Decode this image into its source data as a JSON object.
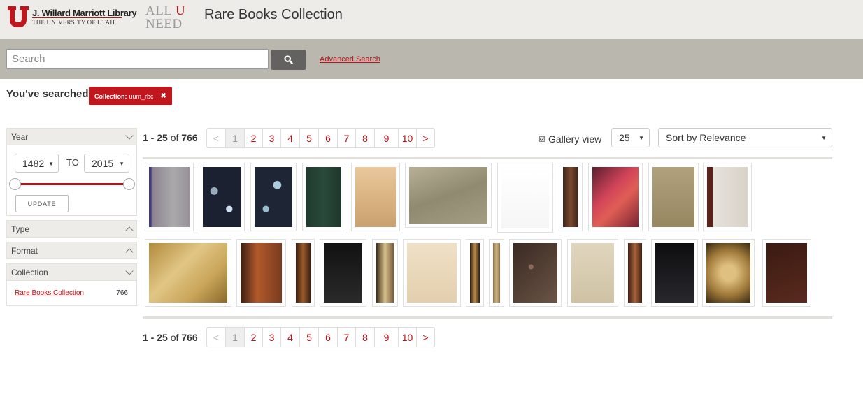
{
  "header": {
    "library_name": "J. Willard Marriott Library",
    "library_sub": "THE UNIVERSITY OF UTAH",
    "allu_line1_a": "ALL",
    "allu_line1_b": "U",
    "allu_line2": "NEED",
    "title": "Rare Books Collection"
  },
  "search": {
    "placeholder": "Search",
    "value": "",
    "advanced_label": "Advanced Search"
  },
  "searched": {
    "label": "You've searched:",
    "facet_key": "Collection:",
    "facet_value": "uum_rbc",
    "remove_icon": "close-icon"
  },
  "sidebar": {
    "year": {
      "label": "Year",
      "from": "1482",
      "to": "2015",
      "to_label": "TO",
      "update_label": "UPDATE",
      "range_fraction": [
        0,
        1
      ]
    },
    "type": {
      "label": "Type"
    },
    "format": {
      "label": "Format"
    },
    "collection": {
      "label": "Collection",
      "items": [
        {
          "label": "Rare Books Collection",
          "count": "766"
        }
      ]
    }
  },
  "results": {
    "range": "1 - 25",
    "of": "of",
    "total": "766",
    "pages": [
      "<",
      "1",
      "2",
      "3",
      "4",
      "5",
      "6",
      "7",
      "8",
      "9",
      "10",
      ">"
    ],
    "current_page": "1",
    "gallery_label": "Gallery view",
    "per_page": "25",
    "sort": "Sort by Relevance"
  },
  "colors": {
    "accent": "#b8131a",
    "header_bg": "#eeece8",
    "search_bg": "#bab7ae"
  }
}
